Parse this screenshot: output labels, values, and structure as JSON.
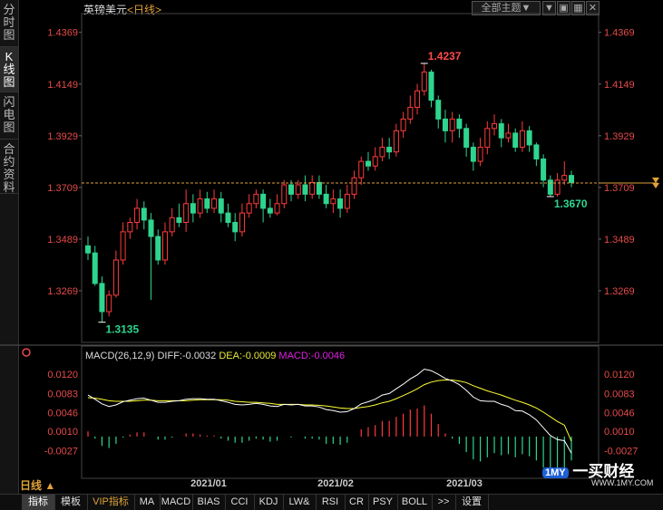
{
  "sidebar": {
    "tabs": [
      {
        "label": "分时图",
        "active": false
      },
      {
        "label": "K线图",
        "active": true
      },
      {
        "label": "闪电图",
        "active": false
      },
      {
        "label": "合约资料",
        "active": false
      }
    ]
  },
  "header": {
    "instrument": "英镑美元",
    "period": "<日线>",
    "theme_select": "全部主题▼"
  },
  "chart_data": [
    {
      "type": "candlestick",
      "ylim": [
        1.3049,
        1.4449
      ],
      "y_ticks": [
        "1.4369",
        "1.4149",
        "1.3929",
        "1.3709",
        "1.3489",
        "1.3269"
      ],
      "y_tick_values": [
        1.4369,
        1.4149,
        1.3929,
        1.3709,
        1.3489,
        1.3269
      ],
      "x_labels": [
        "2021/01",
        "2021/02",
        "2021/03"
      ],
      "high_label": "1.4237",
      "low_label": "1.3135",
      "recent_low_label": "1.3670",
      "current_price": 1.3728,
      "colors": {
        "up": "#ff3b3b",
        "down": "#2ed58e"
      },
      "candles": [
        [
          1.346,
          1.343,
          1.35,
          1.34
        ],
        [
          1.343,
          1.33,
          1.346,
          1.329
        ],
        [
          1.33,
          1.318,
          1.333,
          1.3135
        ],
        [
          1.318,
          1.325,
          1.327,
          1.316
        ],
        [
          1.325,
          1.34,
          1.344,
          1.324
        ],
        [
          1.34,
          1.352,
          1.356,
          1.338
        ],
        [
          1.352,
          1.356,
          1.358,
          1.349
        ],
        [
          1.356,
          1.362,
          1.366,
          1.353
        ],
        [
          1.362,
          1.357,
          1.365,
          1.353
        ],
        [
          1.357,
          1.35,
          1.36,
          1.323
        ],
        [
          1.35,
          1.34,
          1.353,
          1.338
        ],
        [
          1.34,
          1.352,
          1.356,
          1.338
        ],
        [
          1.352,
          1.358,
          1.362,
          1.35
        ],
        [
          1.358,
          1.356,
          1.364,
          1.354
        ],
        [
          1.356,
          1.364,
          1.37,
          1.352
        ],
        [
          1.364,
          1.36,
          1.368,
          1.356
        ],
        [
          1.36,
          1.366,
          1.37,
          1.358
        ],
        [
          1.366,
          1.362,
          1.369,
          1.36
        ],
        [
          1.362,
          1.366,
          1.37,
          1.36
        ],
        [
          1.366,
          1.36,
          1.369,
          1.356
        ],
        [
          1.36,
          1.356,
          1.364,
          1.354
        ],
        [
          1.356,
          1.352,
          1.36,
          1.348
        ],
        [
          1.352,
          1.36,
          1.364,
          1.35
        ],
        [
          1.36,
          1.364,
          1.368,
          1.358
        ],
        [
          1.364,
          1.368,
          1.37,
          1.362
        ],
        [
          1.368,
          1.362,
          1.37,
          1.356
        ],
        [
          1.362,
          1.36,
          1.366,
          1.358
        ],
        [
          1.36,
          1.364,
          1.368,
          1.359
        ],
        [
          1.364,
          1.372,
          1.374,
          1.362
        ],
        [
          1.372,
          1.368,
          1.374,
          1.365
        ],
        [
          1.368,
          1.372,
          1.374,
          1.366
        ],
        [
          1.372,
          1.368,
          1.376,
          1.365
        ],
        [
          1.368,
          1.373,
          1.376,
          1.366
        ],
        [
          1.373,
          1.368,
          1.376,
          1.366
        ],
        [
          1.368,
          1.364,
          1.372,
          1.362
        ],
        [
          1.364,
          1.366,
          1.37,
          1.36
        ],
        [
          1.366,
          1.362,
          1.37,
          1.358
        ],
        [
          1.362,
          1.368,
          1.372,
          1.36
        ],
        [
          1.368,
          1.375,
          1.378,
          1.366
        ],
        [
          1.375,
          1.382,
          1.384,
          1.372
        ],
        [
          1.382,
          1.38,
          1.386,
          1.378
        ],
        [
          1.38,
          1.384,
          1.388,
          1.378
        ],
        [
          1.384,
          1.388,
          1.392,
          1.382
        ],
        [
          1.388,
          1.386,
          1.392,
          1.383
        ],
        [
          1.386,
          1.395,
          1.398,
          1.384
        ],
        [
          1.395,
          1.4,
          1.403,
          1.392
        ],
        [
          1.4,
          1.405,
          1.41,
          1.398
        ],
        [
          1.405,
          1.412,
          1.415,
          1.402
        ],
        [
          1.412,
          1.42,
          1.4237,
          1.41
        ],
        [
          1.42,
          1.408,
          1.421,
          1.405
        ],
        [
          1.408,
          1.4,
          1.41,
          1.396
        ],
        [
          1.4,
          1.395,
          1.404,
          1.39
        ],
        [
          1.395,
          1.4,
          1.403,
          1.39
        ],
        [
          1.4,
          1.396,
          1.402,
          1.392
        ],
        [
          1.396,
          1.388,
          1.398,
          1.384
        ],
        [
          1.388,
          1.382,
          1.39,
          1.378
        ],
        [
          1.382,
          1.388,
          1.392,
          1.38
        ],
        [
          1.388,
          1.396,
          1.399,
          1.385
        ],
        [
          1.396,
          1.398,
          1.402,
          1.393
        ],
        [
          1.398,
          1.392,
          1.4,
          1.388
        ],
        [
          1.392,
          1.394,
          1.398,
          1.39
        ],
        [
          1.394,
          1.388,
          1.396,
          1.386
        ],
        [
          1.388,
          1.395,
          1.399,
          1.386
        ],
        [
          1.395,
          1.389,
          1.397,
          1.386
        ],
        [
          1.389,
          1.383,
          1.39,
          1.38
        ],
        [
          1.383,
          1.374,
          1.385,
          1.371
        ],
        [
          1.374,
          1.368,
          1.376,
          1.367
        ],
        [
          1.368,
          1.374,
          1.377,
          1.367
        ],
        [
          1.374,
          1.376,
          1.382,
          1.372
        ],
        [
          1.376,
          1.373,
          1.378,
          1.371
        ]
      ]
    },
    {
      "type": "macd",
      "title": "MACD(26,12,9)",
      "diff_label": "DIFF:-0.0032",
      "dea_label": "DEA:-0.0009",
      "macd_label": "MACD:-0.0046",
      "ylim": [
        -0.007,
        0.015
      ],
      "y_ticks": [
        "0.0120",
        "0.0083",
        "0.0046",
        "0.0010",
        "-0.0027"
      ],
      "y_tick_values": [
        0.012,
        0.0083,
        0.0046,
        0.001,
        -0.0027
      ],
      "colors": {
        "diff": "#ffffff",
        "dea": "#ffff33",
        "macd": "#e020e0"
      },
      "diff": [
        0.008,
        0.0072,
        0.0063,
        0.0058,
        0.0061,
        0.0067,
        0.007,
        0.0073,
        0.0074,
        0.007,
        0.0066,
        0.0066,
        0.0068,
        0.0069,
        0.0072,
        0.0073,
        0.0073,
        0.0072,
        0.0072,
        0.0069,
        0.0066,
        0.0062,
        0.0061,
        0.0062,
        0.0064,
        0.0062,
        0.0059,
        0.0058,
        0.0062,
        0.0061,
        0.0062,
        0.0059,
        0.0059,
        0.0057,
        0.0052,
        0.005,
        0.0047,
        0.0048,
        0.0054,
        0.0063,
        0.0067,
        0.0072,
        0.008,
        0.0083,
        0.0092,
        0.0101,
        0.0111,
        0.0119,
        0.013,
        0.0127,
        0.012,
        0.0112,
        0.0107,
        0.01,
        0.0089,
        0.0076,
        0.0069,
        0.0068,
        0.0068,
        0.0062,
        0.0058,
        0.005,
        0.0049,
        0.0042,
        0.0032,
        0.0017,
        0.0002,
        -0.0006,
        -0.0008,
        -0.0032
      ],
      "dea": [
        0.0075,
        0.0074,
        0.0072,
        0.0069,
        0.0068,
        0.0068,
        0.0068,
        0.0069,
        0.007,
        0.007,
        0.0069,
        0.0069,
        0.0069,
        0.0069,
        0.0069,
        0.007,
        0.0071,
        0.0071,
        0.0071,
        0.0071,
        0.007,
        0.0068,
        0.0067,
        0.0066,
        0.0066,
        0.0065,
        0.0064,
        0.0062,
        0.0062,
        0.0062,
        0.0062,
        0.0061,
        0.0061,
        0.006,
        0.0059,
        0.0057,
        0.0055,
        0.0054,
        0.0054,
        0.0056,
        0.0058,
        0.0061,
        0.0065,
        0.0068,
        0.0073,
        0.0079,
        0.0085,
        0.0092,
        0.01,
        0.0105,
        0.0108,
        0.0109,
        0.0109,
        0.0107,
        0.0104,
        0.0098,
        0.0093,
        0.0088,
        0.0084,
        0.008,
        0.0075,
        0.007,
        0.0066,
        0.0061,
        0.0055,
        0.0047,
        0.0038,
        0.0029,
        0.0022,
        -0.0009
      ],
      "macd": [
        0.001,
        -0.0004,
        -0.0018,
        -0.0022,
        -0.0014,
        -0.0002,
        0.0004,
        0.0008,
        0.0008,
        0.0,
        -0.0006,
        -0.0006,
        -0.0002,
        0.0,
        0.0006,
        0.0006,
        0.0004,
        0.0002,
        0.0002,
        -0.0004,
        -0.0008,
        -0.0012,
        -0.0012,
        -0.0008,
        -0.0004,
        -0.0006,
        -0.001,
        -0.0008,
        0.0,
        -0.0002,
        0.0,
        -0.0004,
        -0.0004,
        -0.0006,
        -0.0014,
        -0.0014,
        -0.0016,
        -0.0012,
        0.0,
        0.0014,
        0.0018,
        0.0022,
        0.003,
        0.003,
        0.0038,
        0.0044,
        0.0052,
        0.0054,
        0.006,
        0.0044,
        0.0024,
        0.0006,
        -0.0004,
        -0.0014,
        -0.003,
        -0.0044,
        -0.0048,
        -0.004,
        -0.0032,
        -0.0036,
        -0.0034,
        -0.004,
        -0.0034,
        -0.0038,
        -0.0046,
        -0.006,
        -0.0072,
        -0.007,
        -0.006,
        -0.0046
      ]
    }
  ],
  "footer": {
    "period_btn": "日线 ▲",
    "tabs": [
      {
        "label": "指标",
        "active": true,
        "vip": false
      },
      {
        "label": "模板",
        "active": false,
        "vip": false
      },
      {
        "label": "VIP指标",
        "active": false,
        "vip": true
      },
      {
        "label": "MA",
        "active": false,
        "vip": false
      },
      {
        "label": "MACD",
        "active": false,
        "vip": false
      },
      {
        "label": "BIAS",
        "active": false,
        "vip": false
      },
      {
        "label": "CCI",
        "active": false,
        "vip": false
      },
      {
        "label": "KDJ",
        "active": false,
        "vip": false
      },
      {
        "label": "LW&",
        "active": false,
        "vip": false
      },
      {
        "label": "RSI",
        "active": false,
        "vip": false
      },
      {
        "label": "CR",
        "active": false,
        "vip": false
      },
      {
        "label": "PSY",
        "active": false,
        "vip": false
      },
      {
        "label": "BOLL",
        "active": false,
        "vip": false
      },
      {
        "label": ">>",
        "active": false,
        "vip": false
      },
      {
        "label": "设置",
        "active": false,
        "vip": false
      }
    ],
    "logo_text": "一买财经",
    "logo_url": "WWW.1MY.COM"
  }
}
